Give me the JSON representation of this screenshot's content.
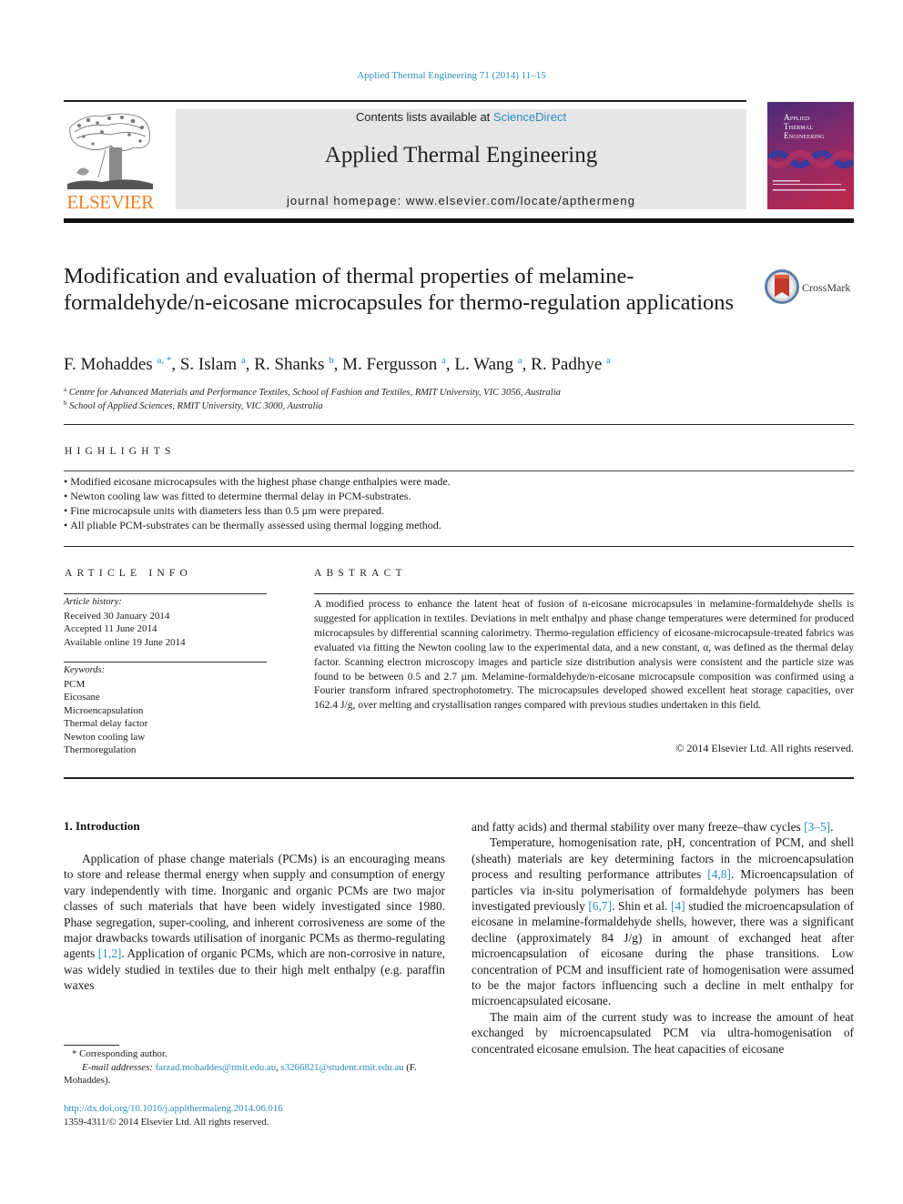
{
  "header": {
    "citation": "Applied Thermal Engineering 71 (2014) 11–15",
    "contents_prefix": "Contents lists available at ",
    "contents_link": "ScienceDirect",
    "journal_title": "Applied Thermal Engineering",
    "homepage_prefix": "journal homepage: ",
    "homepage_url": "www.elsevier.com/locate/apthermeng",
    "publisher_logo_text": "ELSEVIER",
    "cover_title_lines": [
      "Applied",
      "Thermal",
      "Engineering"
    ],
    "colors": {
      "link": "#2a8fbd",
      "elsevier_orange": "#ef7f22",
      "header_box": "#e6e6e6"
    }
  },
  "article": {
    "title": "Modification and evaluation of thermal properties of melamine-formaldehyde/n-eicosane microcapsules for thermo-regulation applications",
    "crossmark_label": "CrossMark",
    "authors": [
      {
        "name": "F. Mohaddes",
        "affil": "a, *"
      },
      {
        "name": "S. Islam",
        "affil": "a"
      },
      {
        "name": "R. Shanks",
        "affil": "b"
      },
      {
        "name": "M. Fergusson",
        "affil": "a"
      },
      {
        "name": "L. Wang",
        "affil": "a"
      },
      {
        "name": "R. Padhye",
        "affil": "a"
      }
    ],
    "affiliations": [
      {
        "mark": "a",
        "text": "Centre for Advanced Materials and Performance Textiles, School of Fashion and Textiles, RMIT University, VIC 3056, Australia"
      },
      {
        "mark": "b",
        "text": "School of Applied Sciences, RMIT University, VIC 3000, Australia"
      }
    ]
  },
  "highlights": {
    "heading": "HIGHLIGHTS",
    "items": [
      "Modified eicosane microcapsules with the highest phase change enthalpies were made.",
      "Newton cooling law was fitted to determine thermal delay in PCM-substrates.",
      "Fine microcapsule units with diameters less than 0.5 µm were prepared.",
      "All pliable PCM-substrates can be thermally assessed using thermal logging method."
    ]
  },
  "article_info": {
    "heading": "ARTICLE INFO",
    "history_label": "Article history:",
    "history": [
      "Received 30 January 2014",
      "Accepted 11 June 2014",
      "Available online 19 June 2014"
    ],
    "keywords_label": "Keywords:",
    "keywords": [
      "PCM",
      "Eicosane",
      "Microencapsulation",
      "Thermal delay factor",
      "Newton cooling law",
      "Thermoregulation"
    ]
  },
  "abstract": {
    "heading": "ABSTRACT",
    "text": "A modified process to enhance the latent heat of fusion of n-eicosane microcapsules in melamine-formaldehyde shells is suggested for application in textiles. Deviations in melt enthalpy and phase change temperatures were determined for produced microcapsules by differential scanning calorimetry. Thermo-regulation efficiency of eicosane-microcapsule-treated fabrics was evaluated via fitting the Newton cooling law to the experimental data, and a new constant, α, was defined as the thermal delay factor. Scanning electron microscopy images and particle size distribution analysis were consistent and the particle size was found to be between 0.5 and 2.7 µm. Melamine-formaldehyde/n-eicosane microcapsule composition was confirmed using a Fourier transform infrared spectrophotometry. The microcapsules developed showed excellent heat storage capacities, over 162.4 J/g, over melting and crystallisation ranges compared with previous studies undertaken in this field.",
    "copyright": "© 2014 Elsevier Ltd. All rights reserved."
  },
  "body": {
    "section_heading": "1.  Introduction",
    "left_para1": {
      "t1": "Application of phase change materials (PCMs) is an encouraging means to store and release thermal energy when supply and consumption of energy vary independently with time. Inorganic and organic PCMs are two major classes of such materials that have been widely investigated since 1980. Phase segregation, super-cooling, and inherent corrosiveness are some of the major drawbacks towards utilisation of inorganic PCMs as thermo-regulating agents ",
      "ref1": "[1,2]",
      "t2": ". Application of organic PCMs, which are non-corrosive in nature, was widely studied in textiles due to their high melt enthalpy (e.g. paraffin waxes"
    },
    "right_para1": {
      "t1": "and fatty acids) and thermal stability over many freeze–thaw cycles ",
      "ref1": "[3–5]",
      "t2": "."
    },
    "right_para2": {
      "t1": "Temperature, homogenisation rate, pH, concentration of PCM, and shell (sheath) materials are key determining factors in the microencapsulation process and resulting performance attributes ",
      "ref1": "[4,8]",
      "t2": ". Microencapsulation of particles via in-situ polymerisation of formaldehyde polymers has been investigated previously ",
      "ref2": "[6,7]",
      "t3": ". Shin et al. ",
      "ref3": "[4]",
      "t4": " studied the microencapsulation of eicosane in melamine-formaldehyde shells, however, there was a significant decline (approximately 84 J/g) in amount of exchanged heat after microencapsulation of eicosane during the phase transitions. Low concentration of PCM and insufficient rate of homogenisation were assumed to be the major factors influencing such a decline in melt enthalpy for microencapsulated eicosane."
    },
    "right_para3": "The main aim of the current study was to increase the amount of heat exchanged by microencapsulated PCM via ultra-homogenisation of concentrated eicosane emulsion. The heat capacities of eicosane"
  },
  "footnotes": {
    "corresponding": "* Corresponding author.",
    "email_label": "E-mail addresses:",
    "email1": "farzad.mohaddes@rmit.edu.au",
    "separator": ", ",
    "email2": "s3266821@student.rmit.edu.au",
    "email_owner": " (F. Mohaddes).",
    "doi": "http://dx.doi.org/10.1016/j.applthermaleng.2014.06.016",
    "issn_line": "1359-4311/© 2014 Elsevier Ltd. All rights reserved."
  }
}
